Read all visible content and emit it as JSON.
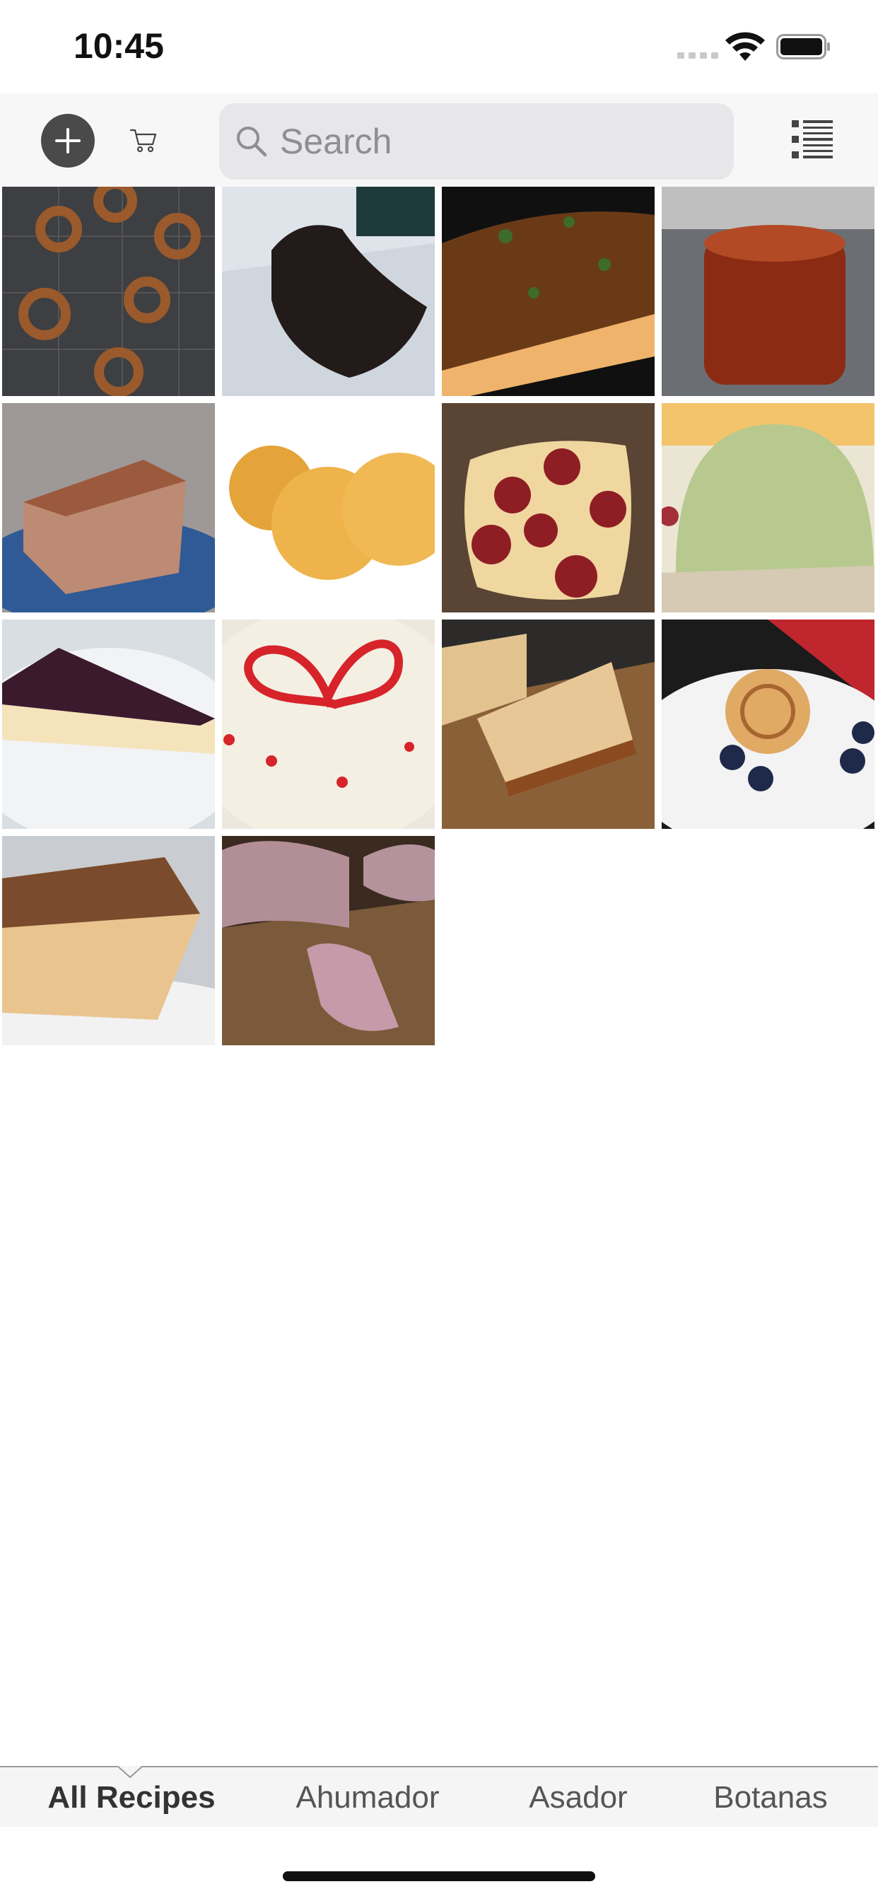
{
  "status_bar": {
    "time": "10:45"
  },
  "toolbar": {
    "search": {
      "placeholder": "Search",
      "value": ""
    },
    "icons": {
      "add": "plus-circle-icon",
      "cart": "shopping-cart-icon",
      "search": "magnifier-icon",
      "list_view": "list-view-icon"
    }
  },
  "recipes": [
    {
      "id": "r1",
      "thumbnail": "pretzels"
    },
    {
      "id": "r2",
      "thumbnail": "smoked-brisket"
    },
    {
      "id": "r3",
      "thumbnail": "onion-tart"
    },
    {
      "id": "r4",
      "thumbnail": "bbq-sauce-jar"
    },
    {
      "id": "r5",
      "thumbnail": "meat-loaf"
    },
    {
      "id": "r6",
      "thumbnail": "fried-chips"
    },
    {
      "id": "r7",
      "thumbnail": "pepperoni-pizza"
    },
    {
      "id": "r8",
      "thumbnail": "green-pudding"
    },
    {
      "id": "r9",
      "thumbnail": "berry-cheesecake-slice"
    },
    {
      "id": "r10",
      "thumbnail": "heart-cake"
    },
    {
      "id": "r11",
      "thumbnail": "bread-loaves"
    },
    {
      "id": "r12",
      "thumbnail": "apple-rose-tart"
    },
    {
      "id": "r13",
      "thumbnail": "tiramisu"
    },
    {
      "id": "r14",
      "thumbnail": "sliced-pork"
    }
  ],
  "tabs": [
    {
      "label": "All Recipes",
      "active": true
    },
    {
      "label": "Ahumador",
      "active": false
    },
    {
      "label": "Asador",
      "active": false
    },
    {
      "label": "Botanas",
      "active": false
    }
  ],
  "colors": {
    "toolbar_bg": "#f7f7f7",
    "search_bg": "#e7e7ea",
    "add_button": "#4a4a4a",
    "tab_bar_bg": "#f5f5f5"
  }
}
